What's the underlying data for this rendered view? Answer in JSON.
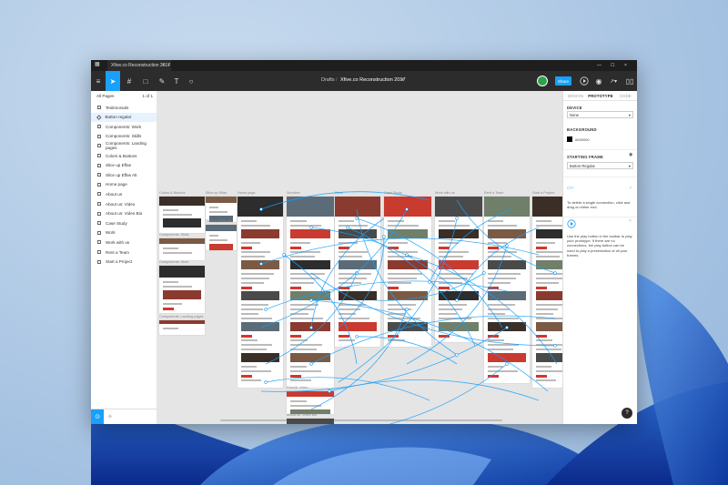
{
  "window": {
    "tab_title": "Xfive.co Reconstruction 2017",
    "tab_close": "×",
    "tab_add": "+",
    "win_min": "—",
    "win_max": "☐",
    "win_close": "×"
  },
  "toolbar": {
    "breadcrumb_folder": "Drafts",
    "breadcrumb_sep": "/",
    "file_name": "Xfive.co Reconstruction 2017",
    "share_label": "Share",
    "tools": [
      "≡",
      "➤",
      "#",
      "□",
      "✎",
      "T",
      "○"
    ]
  },
  "pages_panel": {
    "header": "All Pages",
    "page_count": "1 of 1",
    "items": [
      {
        "label": "Testimonials",
        "kind": "frame"
      },
      {
        "label": "Button regular",
        "kind": "component",
        "selected": true
      },
      {
        "label": "Components: Work",
        "kind": "frame"
      },
      {
        "label": "Components: Skills",
        "kind": "frame"
      },
      {
        "label": "Components: Landing pages",
        "kind": "frame"
      },
      {
        "label": "Colors & Buttons",
        "kind": "frame"
      },
      {
        "label": "Slice up Effas",
        "kind": "frame"
      },
      {
        "label": "Slice up Effas Alt",
        "kind": "frame"
      },
      {
        "label": "Home page",
        "kind": "frame"
      },
      {
        "label": "About us",
        "kind": "frame"
      },
      {
        "label": "About us: Video",
        "kind": "frame"
      },
      {
        "label": "About us: Video Bio",
        "kind": "frame"
      },
      {
        "label": "Case Study",
        "kind": "frame"
      },
      {
        "label": "Work",
        "kind": "frame"
      },
      {
        "label": "Work with us",
        "kind": "frame"
      },
      {
        "label": "Rent a Team",
        "kind": "frame"
      },
      {
        "label": "Start a Project",
        "kind": "frame"
      }
    ]
  },
  "canvas": {
    "frame_labels": [
      "Colors & Buttons",
      "Slice up Effas",
      "Home page",
      "Services",
      "Work",
      "Case Study",
      "Work with us",
      "Rent a Team",
      "Start a Project",
      "Components: Skills",
      "Components: Work",
      "Slice up Effas Alt",
      "Components: Landing pages",
      "Rebuilt: Video",
      "About us: Video Bio"
    ]
  },
  "inspector": {
    "tabs": [
      "DESIGN",
      "PROTOTYPE",
      "CODE"
    ],
    "active_tab": "PROTOTYPE",
    "device_heading": "DEVICE",
    "device_value": "None",
    "background_heading": "BACKGROUND",
    "background_value": "#000000",
    "background_color": "#000000",
    "starting_frame_heading": "STARTING FRAME",
    "starting_frame_value": "Button Regular",
    "tip_connection": "To delete a single connection, click and drag on either end.",
    "tip_play": "Use the play button in the toolbar to play your prototype. If there are no connections, the play button can be used to play a presentation of all your frames."
  },
  "colors": {
    "accent": "#18a0fb",
    "toolbar": "#2c2c2c",
    "titlebar": "#1e1e1e",
    "canvas": "#e5e5e5"
  }
}
